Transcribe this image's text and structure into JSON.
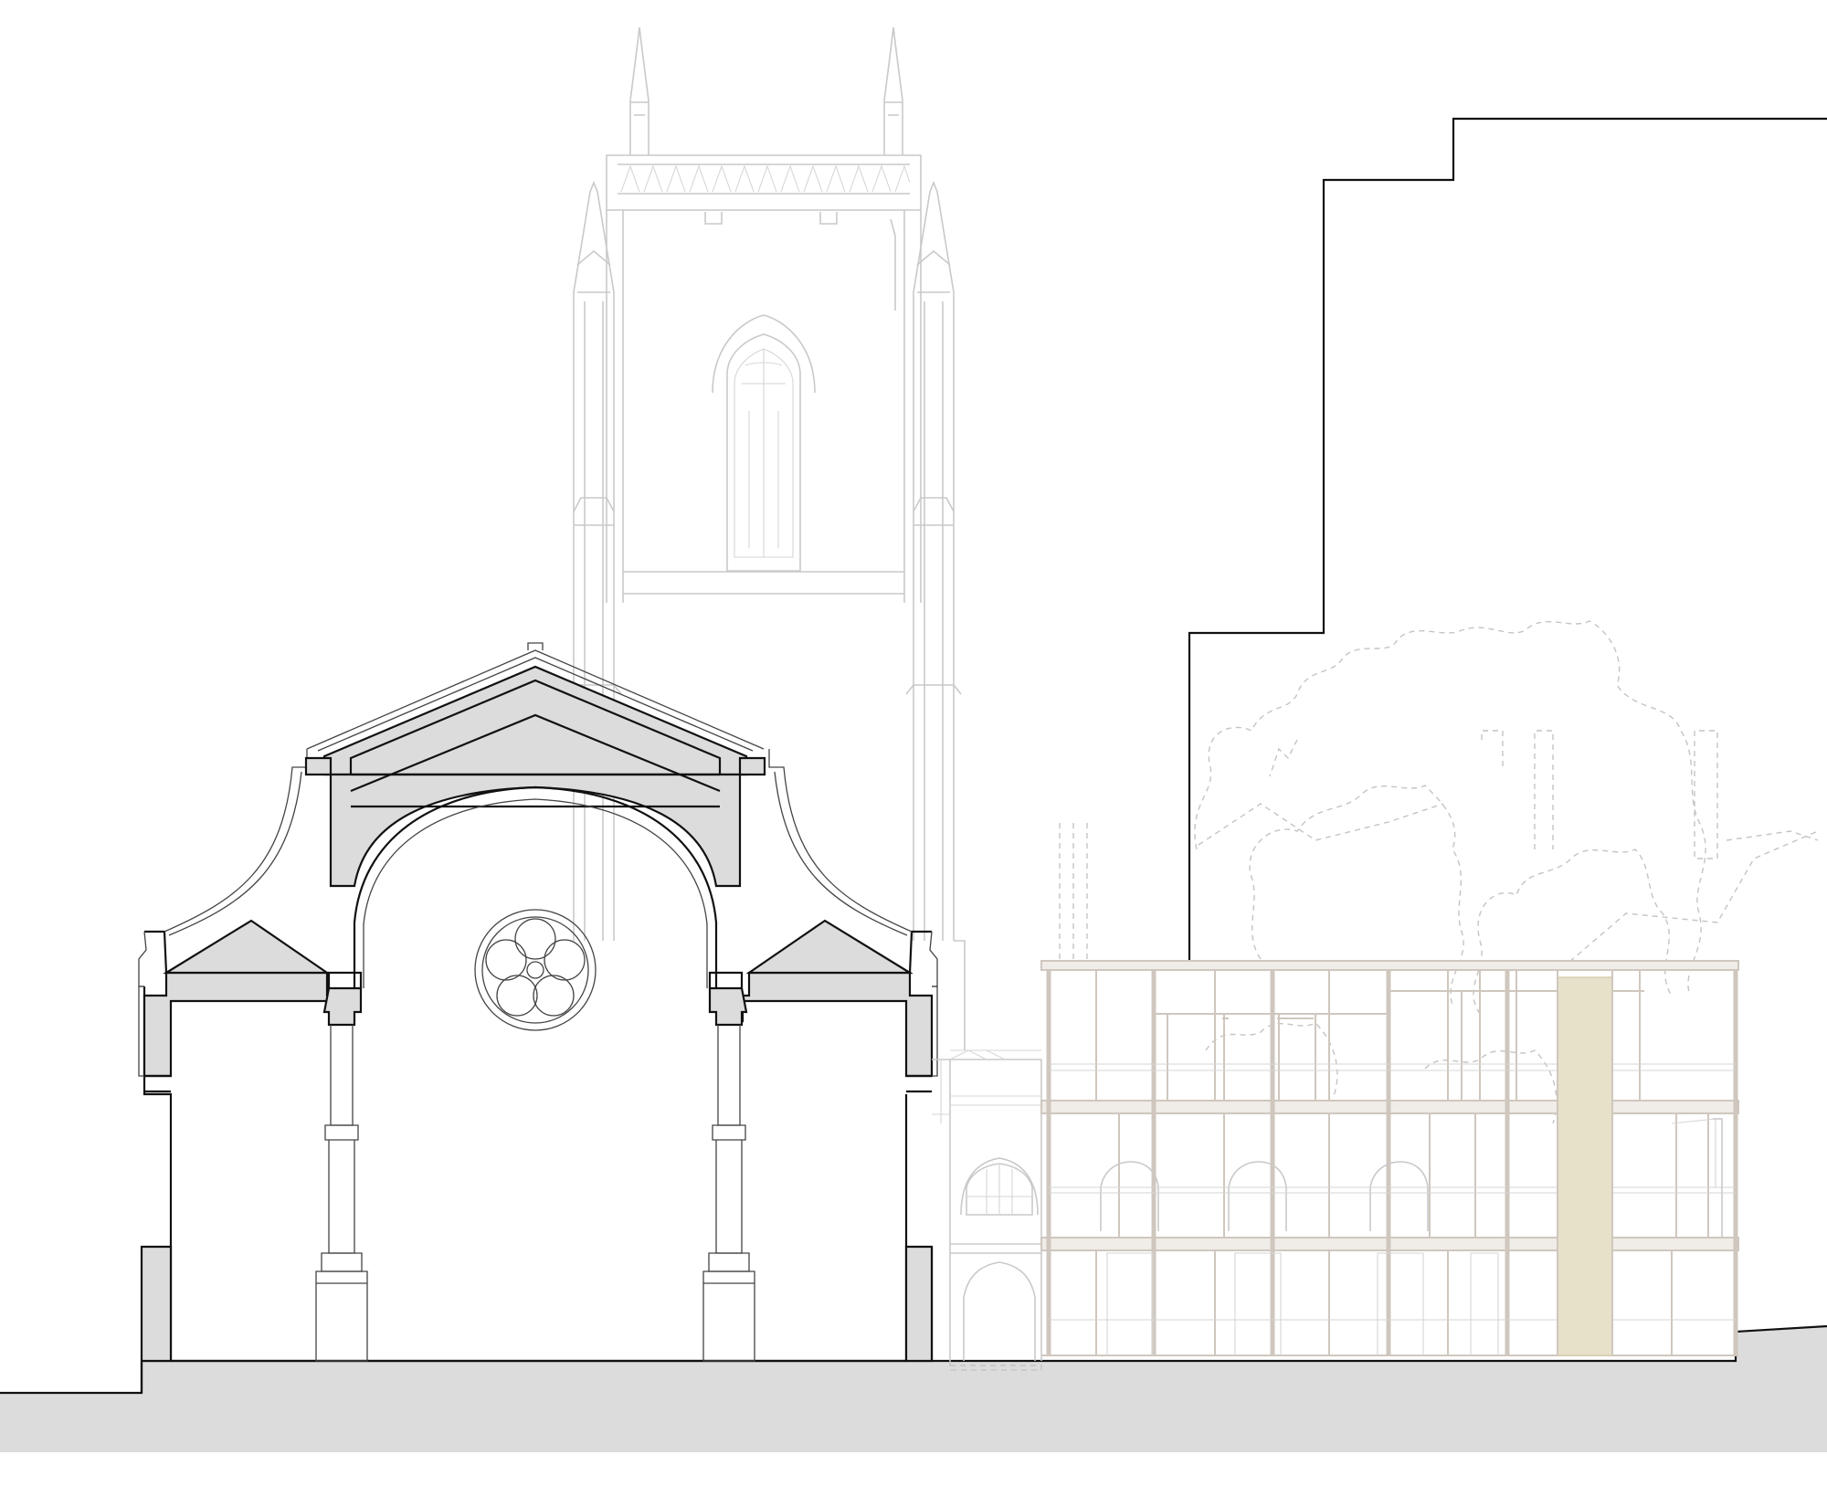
{
  "drawing": {
    "kind": "architectural section elevation",
    "colors": {
      "ground": "#dcdcdc",
      "cut_fill": "#dcdcdc",
      "section_line": "#111111",
      "ghost_line": "#c9c9c9",
      "new_frame": "#cfc7be",
      "stair_core": "#e6e1c8"
    },
    "elements": [
      "church-tower",
      "church-section",
      "neighbouring-block",
      "new-building",
      "background-trees",
      "ground"
    ]
  }
}
